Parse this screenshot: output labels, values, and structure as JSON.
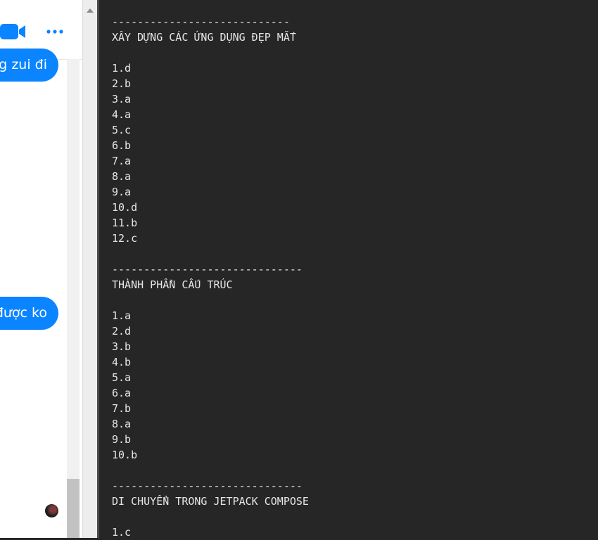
{
  "chat": {
    "bubble_1": "g zui đi",
    "bubble_2": "được ko",
    "accent": "#0a84ff"
  },
  "document": {
    "lines": [
      "----------------------------",
      "XÂY DỰNG CÁC ỨNG DỤNG ĐẸP MẮT",
      "",
      "1.d",
      "2.b",
      "3.a",
      "4.a",
      "5.c",
      "6.b",
      "7.a",
      "8.a",
      "9.a",
      "10.d",
      "11.b",
      "12.c",
      "",
      "------------------------------",
      "THÀNH PHẦN CẤU TRÚC",
      "",
      "1.a",
      "2.d",
      "3.b",
      "4.b",
      "5.a",
      "6.a",
      "7.b",
      "8.a",
      "9.b",
      "10.b",
      "",
      "------------------------------",
      "DI CHUYỂN TRONG JETPACK COMPOSE",
      "",
      "1.c"
    ]
  }
}
